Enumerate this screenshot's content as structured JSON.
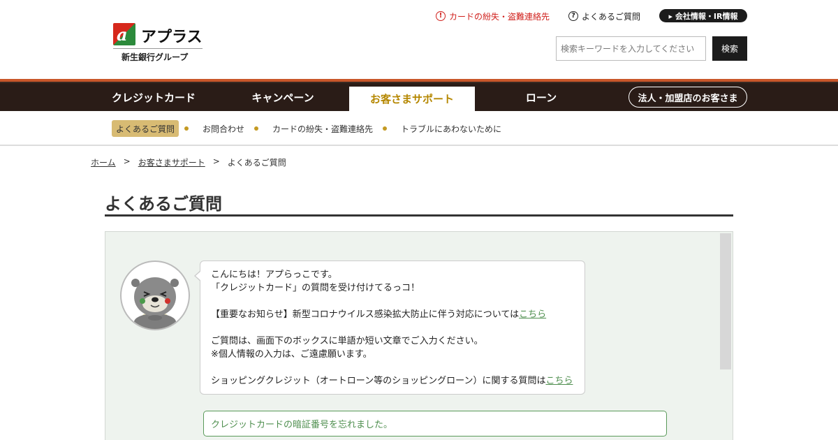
{
  "brand": {
    "logo_glyph": "a",
    "name": "アプラス",
    "group": "新生銀行グループ"
  },
  "utility": {
    "lost_card": "カードの紛失・盗難連絡先",
    "faq": "よくあるご質問",
    "corporate": "▸ 会社情報・IR情報"
  },
  "search": {
    "placeholder": "検索キーワードを入力してください",
    "button": "検索"
  },
  "nav": {
    "items": [
      {
        "label": "クレジットカード"
      },
      {
        "label": "キャンペーン"
      },
      {
        "label": "お客さまサポート"
      },
      {
        "label": "ローン"
      }
    ],
    "corp_button": "法人・加盟店のお客さま"
  },
  "subnav": {
    "items": [
      {
        "label": "よくあるご質問"
      },
      {
        "label": "お問合わせ"
      },
      {
        "label": "カードの紛失・盗難連絡先"
      },
      {
        "label": "トラブルにあわないために"
      }
    ]
  },
  "breadcrumb": {
    "home": "ホーム",
    "support": "お客さまサポート",
    "current": "よくあるご質問",
    "sep": ">"
  },
  "page": {
    "title": "よくあるご質問"
  },
  "chat": {
    "greeting1": "こんにちは！アプらっこです。",
    "greeting2": "「クレジットカード」の質問を受け付けてるっコ！",
    "notice_text": "【重要なお知らせ】新型コロナウイルス感染拡大防止に伴う対応については",
    "notice_link": "こちら",
    "instruct1": "ご質問は、画面下のボックスに単語か短い文章でご入力ください。",
    "instruct2": "※個人情報の入力は、ご遠慮願います。",
    "shopping_text": "ショッピングクレジット（オートローン等のショッピングローン）に関する質問は",
    "shopping_link": "こちら",
    "user_query": "クレジットカードの暗証番号を忘れました。"
  },
  "colors": {
    "nav_bg": "#2a1c17",
    "accent": "#c9572a",
    "active_nav_text": "#b58700",
    "link_green": "#4f8f4f",
    "alert_red": "#d0201c"
  }
}
